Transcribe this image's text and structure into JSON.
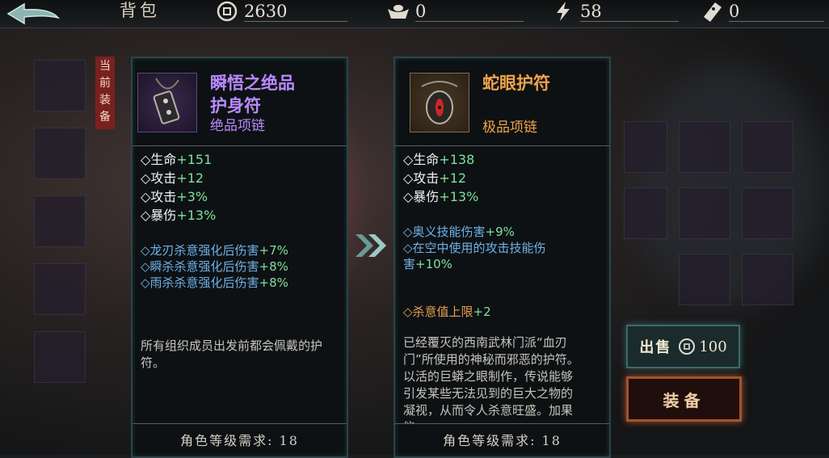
{
  "topbar": {
    "title": "背包",
    "currencies": [
      {
        "icon": "coin-icon",
        "value": "2630"
      },
      {
        "icon": "silver-ingot-icon",
        "value": "0"
      },
      {
        "icon": "lightning-icon",
        "value": "58"
      },
      {
        "icon": "ticket-icon",
        "value": "0"
      }
    ]
  },
  "current_tag": "当前装备",
  "left_card": {
    "name_line1": "瞬悟之绝品",
    "name_line2": "护身符",
    "type": "绝品项链",
    "name_color": "#b88aff",
    "type_color": "#b88aff",
    "stats": [
      {
        "label": "◇生命",
        "value": "+151"
      },
      {
        "label": "◇攻击",
        "value": "+12"
      },
      {
        "label": "◇攻击",
        "value": "+3%"
      },
      {
        "label": "◇暴伤",
        "value": "+13%"
      }
    ],
    "skills": [
      {
        "label": "◇龙刃杀意强化后伤害",
        "value": "+7%"
      },
      {
        "label": "◇瞬杀杀意强化后伤害",
        "value": "+8%"
      },
      {
        "label": "◇雨杀杀意强化后伤害",
        "value": "+8%"
      }
    ],
    "description": "所有组织成员出发前都会佩戴的护符。",
    "requirement": "角色等级需求: 18"
  },
  "right_card": {
    "name": "蛇眼护符",
    "type": "极品项链",
    "name_color": "#f0a24a",
    "type_color": "#f0a24a",
    "stats": [
      {
        "label": "◇生命",
        "value": "+138"
      },
      {
        "label": "◇攻击",
        "value": "+12"
      },
      {
        "label": "◇暴伤",
        "value": "+13%"
      }
    ],
    "skill_1": {
      "label": "◇奥义技能伤害",
      "value": "+9%"
    },
    "skill_2_line1": "◇在空中使用的攻击技能伤",
    "skill_2_line2_label": "害",
    "skill_2_value": "+10%",
    "bonus": {
      "label": "◇杀意值上限",
      "value": "+2"
    },
    "description": "已经覆灭的西南武林门派“血刃门”所使用的神秘而邪恶的护符。以活的巨蟒之眼制作，传说能够引发某些无法见到的巨大之物的凝视，从而令人杀意旺盛。加果能",
    "requirement": "角色等级需求: 18"
  },
  "actions": {
    "sell_label": "出售",
    "sell_price": "100",
    "equip_label": "装备"
  }
}
